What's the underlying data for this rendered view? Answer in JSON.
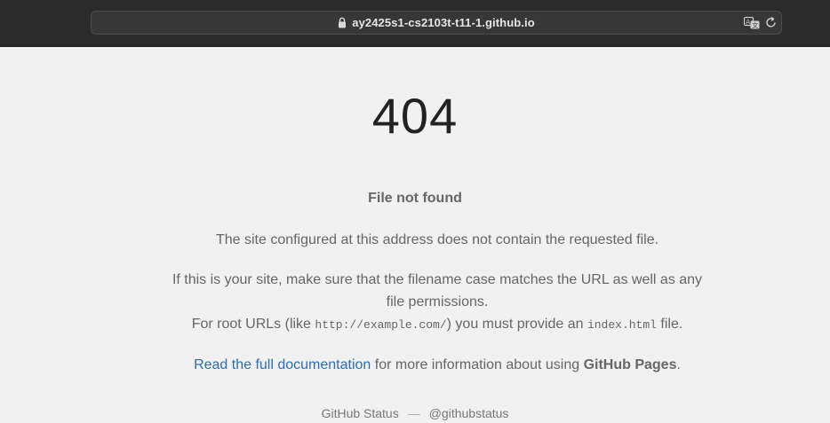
{
  "browser": {
    "url": "ay2425s1-cs2103t-t11-1.github.io",
    "icons": {
      "lock": "lock-icon",
      "translate": "translate-icon",
      "reload": "reload-icon"
    }
  },
  "page": {
    "code": "404",
    "heading": "File not found",
    "paragraph1": "The site configured at this address does not contain the requested file.",
    "paragraph2": "If this is your site, make sure that the filename case matches the URL as well as any file permissions.",
    "paragraph3": {
      "before": "For root URLs (like ",
      "example_url": "http://example.com/",
      "middle": ") you must provide an ",
      "filename": "index.html",
      "after": " file."
    },
    "paragraph4": {
      "link_text": "Read the full documentation",
      "middle": " for more information about using ",
      "product": "GitHub Pages",
      "after": "."
    },
    "footer": {
      "status_link": "GitHub Status",
      "separator": "—",
      "twitter_link": "@githubstatus"
    }
  },
  "colors": {
    "link": "#2a6eb5",
    "text": "#666666",
    "background": "#f1f1f1",
    "toolbar": "#2b2b2b"
  }
}
